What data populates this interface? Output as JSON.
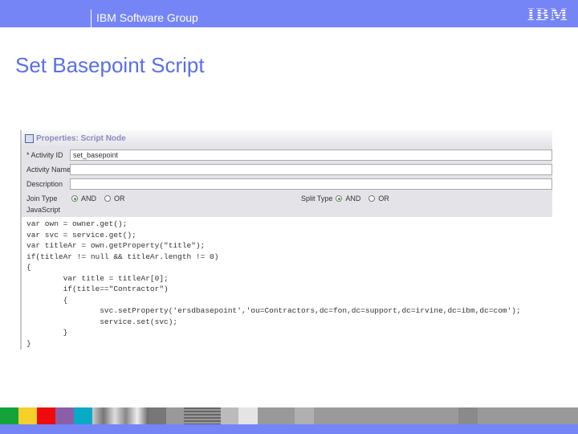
{
  "header": {
    "group": "IBM Software Group",
    "logo": "IBM"
  },
  "slide": {
    "title": "Set Basepoint Script"
  },
  "panel": {
    "title": "Properties: Script Node",
    "activity_id_label": "* Activity ID",
    "activity_id_value": "set_basepoint",
    "activity_name_label": "Activity Name",
    "activity_name_value": "",
    "description_label": "Description",
    "description_value": "",
    "join_type_label": "Join Type",
    "split_type_label": "Split Type",
    "and_label": "AND",
    "or_label": "OR",
    "javascript_label": "JavaScript",
    "code": "var own = owner.get();\nvar svc = service.get();\nvar titleAr = own.getProperty(\"title\");\nif(titleAr != null && titleAr.length != 0)\n{\n        var title = titleAr[0];\n        if(title==\"Contractor\")\n        {\n                svc.setProperty('ersdbasepoint','ou=Contractors,dc=fon,dc=support,dc=irvine,dc=ibm,dc=com');\n                service.set(svc);\n        }\n}"
  },
  "colors": {
    "brand": "#7585f5"
  }
}
